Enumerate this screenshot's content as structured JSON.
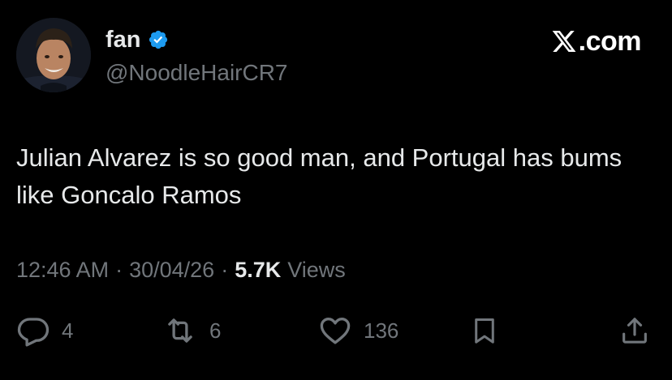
{
  "user": {
    "display_name": "fan",
    "handle": "@NoodleHairCR7",
    "verified": true,
    "verified_color": "#1d9bf0"
  },
  "brand": {
    "text": ".com",
    "icon": "x-logo-icon"
  },
  "tweet": {
    "text": "Julian Alvarez is so good man, and Portugal has bums like Goncalo Ramos"
  },
  "meta": {
    "time": "12:46 AM",
    "separator": "·",
    "date": "30/04/26",
    "views_count": "5.7K",
    "views_label": "Views"
  },
  "actions": {
    "reply": {
      "icon": "reply-icon",
      "count": "4"
    },
    "retweet": {
      "icon": "retweet-icon",
      "count": "6"
    },
    "like": {
      "icon": "heart-icon",
      "count": "136"
    },
    "bookmark": {
      "icon": "bookmark-icon"
    },
    "share": {
      "icon": "share-icon"
    }
  },
  "colors": {
    "background": "#000000",
    "text_primary": "#e7e9ea",
    "text_secondary": "#71767b"
  }
}
